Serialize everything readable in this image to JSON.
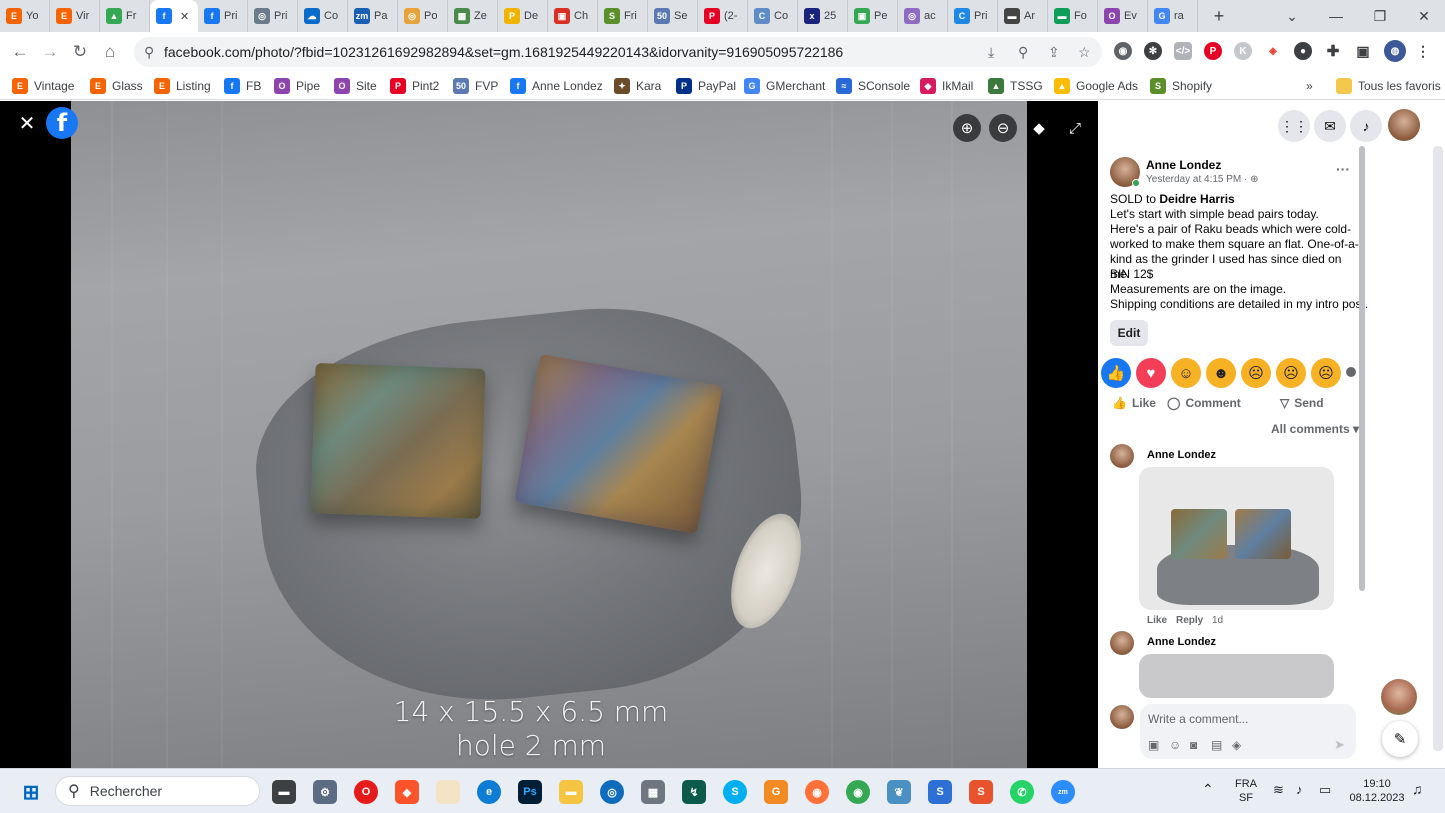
{
  "browser": {
    "tabs": [
      {
        "label": "Yo",
        "color": "#f56400",
        "glyph": "E"
      },
      {
        "label": "Vir",
        "color": "#f56400",
        "glyph": "E"
      },
      {
        "label": "Fr",
        "color": "#34a853",
        "glyph": "▲"
      },
      {
        "label": "",
        "color": "#1877f2",
        "glyph": "f",
        "active": true
      },
      {
        "label": "Pri",
        "color": "#1877f2",
        "glyph": "f"
      },
      {
        "label": "Pri",
        "color": "#6b7b8c",
        "glyph": "◎"
      },
      {
        "label": "Co",
        "color": "#0b6bcb",
        "glyph": "☁"
      },
      {
        "label": "Pa",
        "color": "#1a5fb4",
        "glyph": "zm"
      },
      {
        "label": "Po",
        "color": "#e8a33d",
        "glyph": "◎"
      },
      {
        "label": "Ze",
        "color": "#4a8a4a",
        "glyph": "▦"
      },
      {
        "label": "De",
        "color": "#f0b400",
        "glyph": "P"
      },
      {
        "label": "Ch",
        "color": "#d93025",
        "glyph": "▣"
      },
      {
        "label": "Fri",
        "color": "#5a8f29",
        "glyph": "S"
      },
      {
        "label": "Se",
        "color": "#5b79b3",
        "glyph": "50"
      },
      {
        "label": "(2-",
        "color": "#e60023",
        "glyph": "P"
      },
      {
        "label": "Co",
        "color": "#5f8cc4",
        "glyph": "C"
      },
      {
        "label": "25",
        "color": "#1a237e",
        "glyph": "x"
      },
      {
        "label": "Pe",
        "color": "#34a853",
        "glyph": "▣"
      },
      {
        "label": "ac",
        "color": "#8e6cc4",
        "glyph": "◎"
      },
      {
        "label": "Pri",
        "color": "#1e88e5",
        "glyph": "C"
      },
      {
        "label": "Ar",
        "color": "#444444",
        "glyph": "▬"
      },
      {
        "label": "Fo",
        "color": "#0f9d58",
        "glyph": "▬"
      },
      {
        "label": "Ev",
        "color": "#8e44ad",
        "glyph": "O"
      },
      {
        "label": "ra",
        "color": "#4285f4",
        "glyph": "G"
      }
    ],
    "url": "facebook.com/photo/?fbid=10231261692982894&set=gm.1681925449220143&idorvanity=916905095722186",
    "bookmarks": [
      {
        "label": "Vintage",
        "color": "#f56400",
        "glyph": "E"
      },
      {
        "label": "Glass",
        "color": "#f56400",
        "glyph": "E"
      },
      {
        "label": "Listing",
        "color": "#f56400",
        "glyph": "E"
      },
      {
        "label": "FB",
        "color": "#1877f2",
        "glyph": "f"
      },
      {
        "label": "Pipe",
        "color": "#8e44ad",
        "glyph": "O"
      },
      {
        "label": "Site",
        "color": "#8e44ad",
        "glyph": "O"
      },
      {
        "label": "Pint2",
        "color": "#e60023",
        "glyph": "P"
      },
      {
        "label": "FVP",
        "color": "#5b79b3",
        "glyph": "50"
      },
      {
        "label": "Anne Londez",
        "color": "#1877f2",
        "glyph": "f"
      },
      {
        "label": "Kara",
        "color": "#6a4c2a",
        "glyph": "✦"
      },
      {
        "label": "PayPal",
        "color": "#003087",
        "glyph": "P"
      },
      {
        "label": "GMerchant",
        "color": "#4285f4",
        "glyph": "G"
      },
      {
        "label": "SConsole",
        "color": "#2a6ad8",
        "glyph": "≈"
      },
      {
        "label": "IkMail",
        "color": "#d81b60",
        "glyph": "◆"
      },
      {
        "label": "TSSG",
        "color": "#3c7a3c",
        "glyph": "▲"
      },
      {
        "label": "Google Ads",
        "color": "#fbbc04",
        "glyph": "▲"
      },
      {
        "label": "Shopify",
        "color": "#5a8f29",
        "glyph": "S"
      }
    ],
    "bookmarks_more": "»",
    "all_bookmarks": "Tous les favoris"
  },
  "viewer": {
    "caption_line1": "14 x 15.5 x 6.5 mm",
    "caption_line2": "hole 2 mm"
  },
  "post": {
    "author": "Anne Londez",
    "timestamp": "Yesterday at 4:15 PM · ",
    "sold_prefix": "SOLD to ",
    "sold_to": "Deidre Harris",
    "body_line1": "Let's start with simple bead pairs today.",
    "body_line2": "Here's a pair of Raku beads which were cold-worked to make them square an flat. One-of-a-kind as the grinder I used has since died on me.",
    "body_line3": "BIN 12$",
    "body_line4": "Measurements are on the image.",
    "body_line5": "Shipping conditions are detailed in my intro post.",
    "edit_label": "Edit",
    "like_label": "Like",
    "comment_label": "Comment",
    "send_label": "Send",
    "all_comments": "All comments",
    "comments": [
      {
        "author": "Anne Londez",
        "like": "Like",
        "reply": "Reply",
        "age": "1d"
      },
      {
        "author": "Anne Londez"
      }
    ],
    "write_placeholder": "Write a comment..."
  },
  "taskbar": {
    "search_placeholder": "Rechercher",
    "lang_line1": "FRA",
    "lang_line2": "SF",
    "time": "19:10",
    "date": "08.12.2023"
  }
}
